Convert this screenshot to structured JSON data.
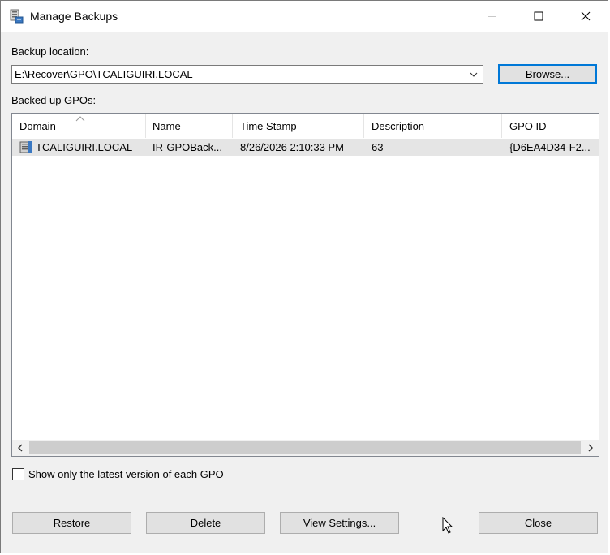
{
  "window": {
    "title": "Manage Backups",
    "icon": "backup-server-icon"
  },
  "titlebar": {
    "minimize": "minimize-icon",
    "maximize": "maximize-icon",
    "close": "close-icon"
  },
  "backup_location": {
    "label": "Backup location:",
    "value": "E:\\Recover\\GPO\\TCALIGUIRI.LOCAL",
    "browse_label": "Browse..."
  },
  "backed_up": {
    "label": "Backed up GPOs:",
    "columns": [
      "Domain",
      "Name",
      "Time Stamp",
      "Description",
      "GPO ID"
    ],
    "rows": [
      {
        "domain": "TCALIGUIRI.LOCAL",
        "name": "IR-GPOBack...",
        "time_stamp": "8/26/2026 2:10:33 PM",
        "description": "63",
        "gpo_id": "{D6EA4D34-F2..."
      }
    ]
  },
  "filter": {
    "label": "Show only the latest version of each GPO",
    "checked": false
  },
  "buttons": {
    "restore": "Restore",
    "delete": "Delete",
    "view_settings": "View Settings...",
    "close": "Close"
  },
  "colors": {
    "accent": "#0078d7",
    "selected_row": "#e5e5e5",
    "window_bg": "#f0f0f0"
  }
}
